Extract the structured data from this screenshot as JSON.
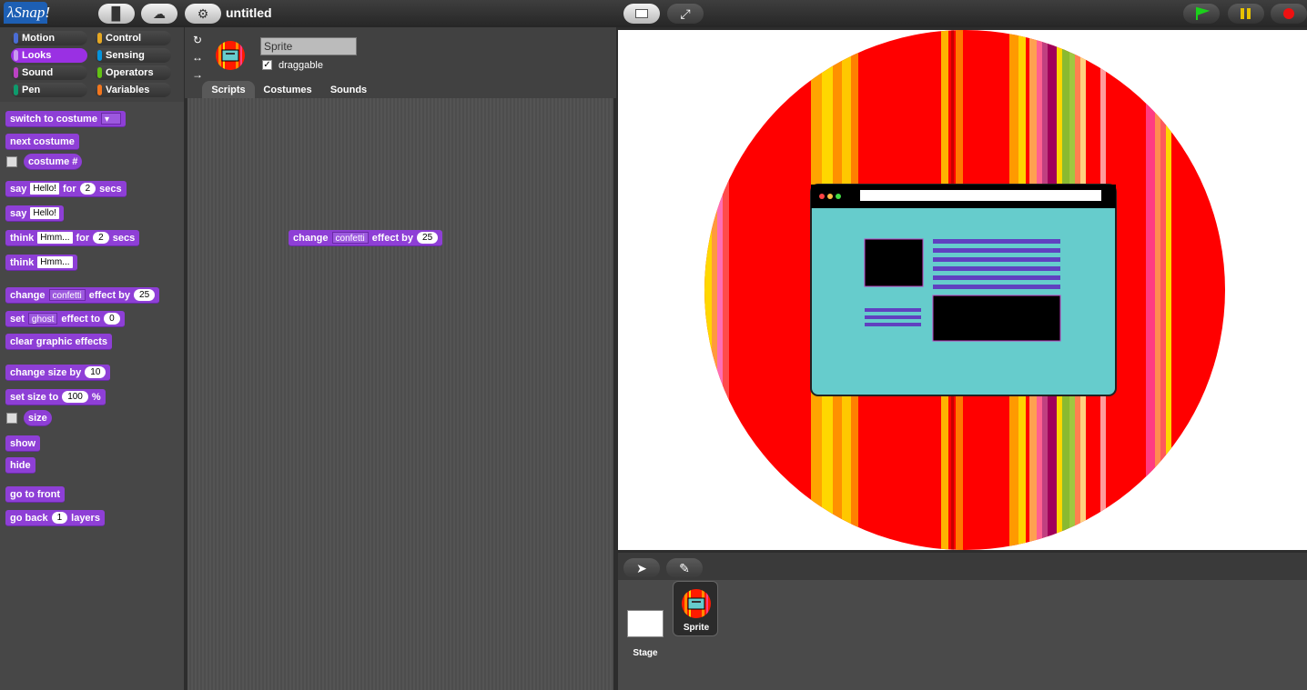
{
  "app": {
    "logo_text": "λSnap!",
    "project_title": "untitled"
  },
  "toolbar": {
    "new_icon": "file-icon",
    "cloud_icon": "cloud-icon",
    "settings_icon": "gear-icon",
    "stage_size_icon": "normal-stage-icon",
    "presentation_icon": "fullscreen-icon"
  },
  "controls": {
    "green_flag_icon": "green-flag-icon",
    "pause_icon": "pause-icon",
    "stop_icon": "stop-icon"
  },
  "categories": [
    {
      "label": "Motion",
      "color": "#4a6cd4"
    },
    {
      "label": "Control",
      "color": "#e6a822"
    },
    {
      "label": "Looks",
      "color": "#8a55d7"
    },
    {
      "label": "Sensing",
      "color": "#0494dc"
    },
    {
      "label": "Sound",
      "color": "#bb42c3"
    },
    {
      "label": "Operators",
      "color": "#62c213"
    },
    {
      "label": "Pen",
      "color": "#0e9a6c"
    },
    {
      "label": "Variables",
      "color": "#f3761d"
    }
  ],
  "blocks": {
    "switch_costume": "switch to costume",
    "next_costume": "next costume",
    "costume_num": "costume #",
    "say_for": {
      "a": "say",
      "slot": "Hello!",
      "b": "for",
      "num": "2",
      "c": "secs"
    },
    "say": {
      "a": "say",
      "slot": "Hello!"
    },
    "think_for": {
      "a": "think",
      "slot": "Hmm...",
      "b": "for",
      "num": "2",
      "c": "secs"
    },
    "think": {
      "a": "think",
      "slot": "Hmm..."
    },
    "change_effect": {
      "a": "change",
      "dd": "confetti",
      "b": "effect by",
      "num": "25"
    },
    "set_effect": {
      "a": "set",
      "dd": "ghost",
      "b": "effect to",
      "num": "0"
    },
    "clear_effects": "clear graphic effects",
    "change_size": {
      "a": "change size by",
      "num": "10"
    },
    "set_size": {
      "a": "set size to",
      "num": "100",
      "b": "%"
    },
    "size": "size",
    "show": "show",
    "hide": "hide",
    "go_front": "go to front",
    "go_back": {
      "a": "go back",
      "num": "1",
      "b": "layers"
    }
  },
  "sprite": {
    "name": "Sprite",
    "draggable_label": "draggable",
    "draggable_check": "✓"
  },
  "tabs": [
    "Scripts",
    "Costumes",
    "Sounds"
  ],
  "script_block": {
    "a": "change",
    "dd": "confetti",
    "b": "effect by",
    "num": "25"
  },
  "corral": {
    "stage_label": "Stage",
    "sprite_label": "Sprite",
    "turtle_icon": "arrow-icon",
    "paint_icon": "paintbrush-icon"
  },
  "colors": {
    "accent_looks": "#8e3fd6",
    "background": "#2d2d2d"
  }
}
